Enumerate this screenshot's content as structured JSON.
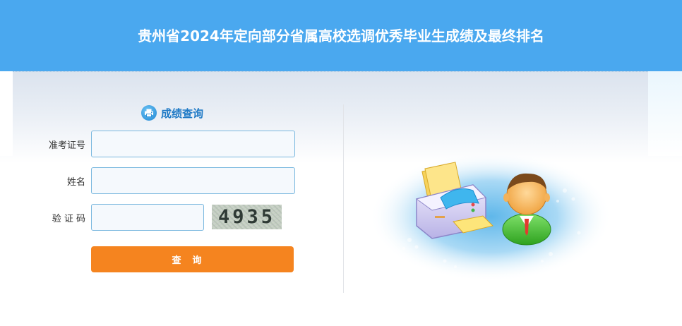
{
  "header": {
    "title": "贵州省2024年定向部分省属高校选调优秀毕业生成绩及最终排名"
  },
  "form": {
    "heading": "成绩查询",
    "fields": [
      {
        "label": "准考证号",
        "value": "",
        "placeholder": ""
      },
      {
        "label": "姓名",
        "value": "",
        "placeholder": ""
      },
      {
        "label": "验 证 码",
        "value": "",
        "placeholder": ""
      }
    ],
    "captcha_text": "4935",
    "submit_label": "查询"
  },
  "colors": {
    "header_bg": "#4aa8ef",
    "button_bg": "#f5841f",
    "heading_text": "#1f7ac6",
    "input_border": "#7ab8df"
  },
  "icons": {
    "heading_icon": "printer-icon",
    "illustration": "printer-and-person-illustration"
  }
}
